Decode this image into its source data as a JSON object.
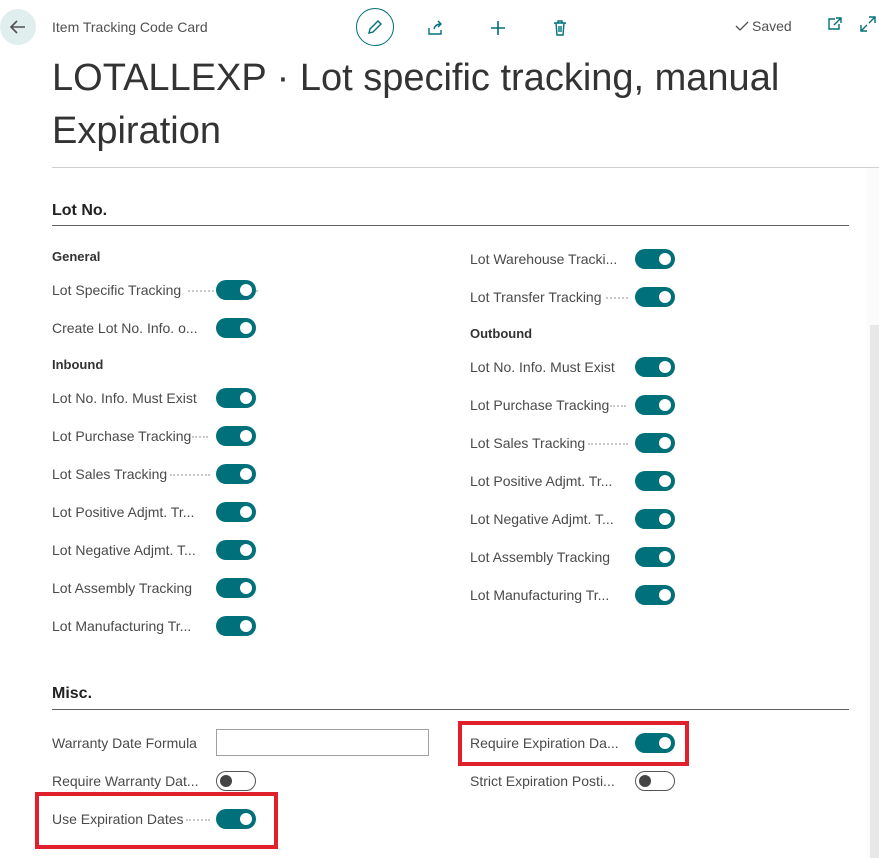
{
  "header": {
    "breadcrumb": "Item Tracking Code Card",
    "saved_label": "Saved"
  },
  "page_title": "LOTALLEXP · Lot specific tracking, manual Expiration",
  "lot_section": {
    "title": "Lot No.",
    "general_header": "General",
    "inbound_header": "Inbound",
    "outbound_header": "Outbound",
    "fields": {
      "lot_specific_tracking": "Lot Specific Tracking",
      "create_lot_info": "Create Lot No. Info. o...",
      "in_info_must_exist": "Lot No. Info. Must Exist",
      "in_purchase": "Lot Purchase Tracking",
      "in_sales": "Lot Sales Tracking",
      "in_pos_adj": "Lot Positive Adjmt. Tr...",
      "in_neg_adj": "Lot Negative Adjmt. T...",
      "in_assembly": "Lot Assembly Tracking",
      "in_manufacturing": "Lot Manufacturing Tr...",
      "warehouse": "Lot Warehouse Tracki...",
      "transfer": "Lot Transfer Tracking",
      "out_info_must_exist": "Lot No. Info. Must Exist",
      "out_purchase": "Lot Purchase Tracking",
      "out_sales": "Lot Sales Tracking",
      "out_pos_adj": "Lot Positive Adjmt. Tr...",
      "out_neg_adj": "Lot Negative Adjmt. T...",
      "out_assembly": "Lot Assembly Tracking",
      "out_manufacturing": "Lot Manufacturing Tr..."
    },
    "toggle_state": "on"
  },
  "misc_section": {
    "title": "Misc.",
    "fields": {
      "warranty_formula": "Warranty Date Formula",
      "warranty_formula_value": "",
      "require_warranty": "Require Warranty Dat...",
      "use_expiration": "Use Expiration Dates",
      "require_expiration": "Require Expiration Da...",
      "strict_expiration": "Strict Expiration Posti..."
    },
    "toggles": {
      "require_warranty": "off",
      "use_expiration": "on",
      "require_expiration": "on",
      "strict_expiration": "off"
    }
  },
  "colors": {
    "accent": "#00707a",
    "highlight": "#e0202a"
  },
  "icons": [
    "back-arrow-icon",
    "edit-pencil-icon",
    "share-icon",
    "add-icon",
    "delete-icon",
    "checkmark-icon",
    "open-new-window-icon",
    "expand-icon"
  ]
}
